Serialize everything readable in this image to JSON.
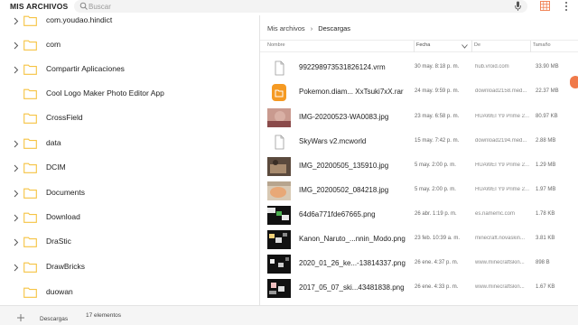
{
  "app": {
    "title": "MIS ARCHIVOS"
  },
  "search": {
    "placeholder": "Buscar"
  },
  "colors": {
    "folder": "#f6c342",
    "accent": "#f07a4a",
    "doc_orange": "#f59a23"
  },
  "tree": {
    "items": [
      {
        "label": "com.youdao.hindict",
        "expandable": true
      },
      {
        "label": "com",
        "expandable": true
      },
      {
        "label": "Compartir Aplicaciones",
        "expandable": true
      },
      {
        "label": "Cool Logo Maker Photo Editor App",
        "expandable": false
      },
      {
        "label": "CrossField",
        "expandable": false
      },
      {
        "label": "data",
        "expandable": true
      },
      {
        "label": "DCIM",
        "expandable": true
      },
      {
        "label": "Documents",
        "expandable": true
      },
      {
        "label": "Download",
        "expandable": true
      },
      {
        "label": "DraStic",
        "expandable": true
      },
      {
        "label": "DrawBricks",
        "expandable": true
      },
      {
        "label": "duowan",
        "expandable": false
      }
    ]
  },
  "breadcrumb": {
    "root": "Mis archivos",
    "sep": "›",
    "current": "Descargas"
  },
  "columns": {
    "name": "Nombre",
    "date": "Fecha",
    "from": "De",
    "size": "Tamaño"
  },
  "files": [
    {
      "name": "992298973531826124.vrm",
      "date": "30 may. 8:18 p. m.",
      "from": "hub.vroid.com",
      "size": "33.90 MB",
      "thumb": "doc-icon"
    },
    {
      "name": "Pokemon.diam... XxTsuki7xX.rar",
      "date": "24 may. 9:59 p. m.",
      "from": "download2158.med...",
      "size": "22.37 MB",
      "thumb": "archive-icon"
    },
    {
      "name": "IMG-20200523-WA0083.jpg",
      "date": "23 may. 6:58 p. m.",
      "from": "HUAWEI Y9 Prime 2...",
      "size": "80.97 KB",
      "thumb": "photo-thumbnail"
    },
    {
      "name": "SkyWars v2.mcworld",
      "date": "15 may. 7:42 p. m.",
      "from": "download2194.med...",
      "size": "2.88 MB",
      "thumb": "doc-icon"
    },
    {
      "name": "IMG_20200505_135910.jpg",
      "date": "5 may. 2:00 p. m.",
      "from": "HUAWEI Y9 Prime 2...",
      "size": "1.29 MB",
      "thumb": "photo-thumbnail"
    },
    {
      "name": "IMG_20200502_084218.jpg",
      "date": "5 may. 2:00 p. m.",
      "from": "HUAWEI Y9 Prime 2...",
      "size": "1.97 MB",
      "thumb": "photo-thumbnail"
    },
    {
      "name": "64d6a771fde67665.png",
      "date": "26 abr. 1:19 p. m.",
      "from": "es.namemc.com",
      "size": "1.78 KB",
      "thumb": "skin-thumbnail"
    },
    {
      "name": "Kanon_Naruto_...nnin_Modo.png",
      "date": "23 feb. 10:39 a. m.",
      "from": "minecraft.novaskin...",
      "size": "3.81 KB",
      "thumb": "skin-thumbnail"
    },
    {
      "name": "2020_01_26_ke...-13814337.png",
      "date": "26 ene. 4:37 p. m.",
      "from": "www.minecraftskin...",
      "size": "898 B",
      "thumb": "skin-thumbnail"
    },
    {
      "name": "2017_05_07_ski...43481838.png",
      "date": "26 ene. 4:33 p. m.",
      "from": "www.minecraftskin...",
      "size": "1.67 KB",
      "thumb": "skin-thumbnail"
    }
  ],
  "bottombar": {
    "location": "Descargas",
    "count": "17 elementos"
  }
}
